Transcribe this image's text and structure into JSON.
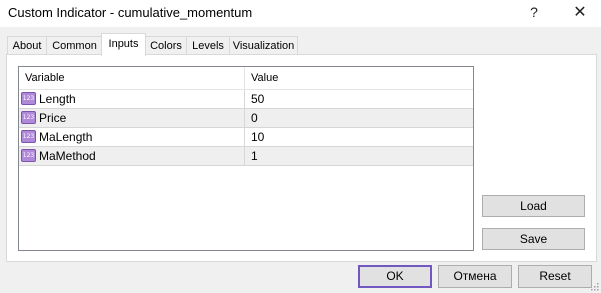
{
  "window": {
    "title": "Custom Indicator - cumulative_momentum",
    "help_glyph": "?",
    "close_glyph": "✕"
  },
  "tabs": [
    "About",
    "Common",
    "Inputs",
    "Colors",
    "Levels",
    "Visualization"
  ],
  "active_tab": "Inputs",
  "grid": {
    "headers": {
      "variable": "Variable",
      "value": "Value"
    },
    "icon_text": "123",
    "rows": [
      {
        "variable": "Length",
        "value": "50"
      },
      {
        "variable": "Price",
        "value": "0"
      },
      {
        "variable": "MaLength",
        "value": "10"
      },
      {
        "variable": "MaMethod",
        "value": "1"
      }
    ]
  },
  "side_buttons": {
    "load": "Load",
    "save": "Save"
  },
  "buttons": {
    "ok": "OK",
    "cancel": "Отмена",
    "reset": "Reset"
  }
}
